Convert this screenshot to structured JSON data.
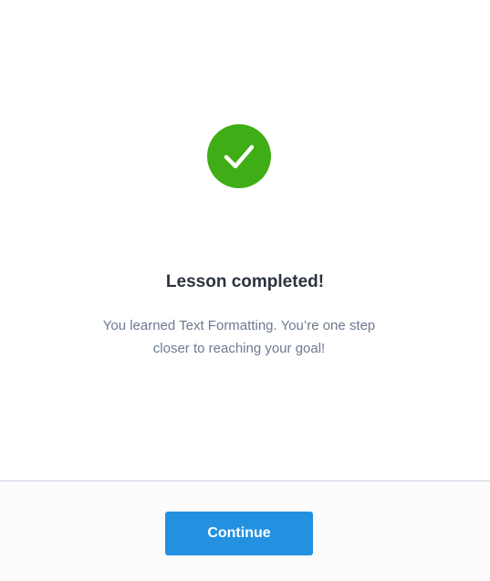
{
  "completion": {
    "icon": "checkmark-icon",
    "title": "Lesson completed!",
    "message_line1": "You learned Text Formatting. You’re one step",
    "message_line2": "closer to reaching your goal!"
  },
  "footer": {
    "continue_label": "Continue"
  },
  "colors": {
    "success_green": "#3fad15",
    "primary_blue": "#2390e0",
    "title_text": "#2b333f",
    "body_text": "#6b7a90"
  }
}
